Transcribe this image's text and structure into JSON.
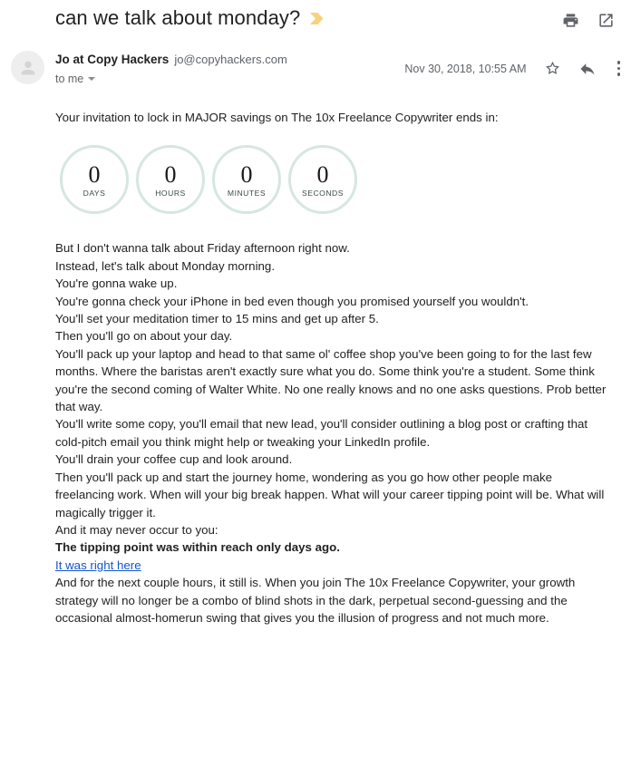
{
  "email": {
    "subject": "can we talk about monday?",
    "important_marker_color": "#f6d27e",
    "sender_name": "Jo at Copy Hackers",
    "sender_email": "jo@copyhackers.com",
    "recipient": "to me",
    "date": "Nov 30, 2018, 10:55 AM"
  },
  "header_actions": {
    "print_label": "Print all",
    "popout_label": "Open in new window"
  },
  "message_actions": {
    "star_label": "Star",
    "reply_label": "Reply",
    "more_label": "More"
  },
  "countdown": {
    "items": [
      {
        "value": "0",
        "label": "DAYS"
      },
      {
        "value": "0",
        "label": "HOURS"
      },
      {
        "value": "0",
        "label": "MINUTES"
      },
      {
        "value": "0",
        "label": "SECONDS"
      }
    ],
    "border_color": "#d6e6e3"
  },
  "body": {
    "intro": "Your invitation to lock in MAJOR savings on The 10x Freelance Copywriter ends in:",
    "paragraphs": [
      "But I don't wanna talk about Friday afternoon right now.",
      "Instead, let's talk about Monday morning.",
      "You're gonna wake up.",
      "You're gonna check your iPhone in bed even though you promised yourself you wouldn't.",
      "You'll set your meditation timer to 15 mins and get up after 5.",
      "Then you'll go on about your day.",
      "You'll pack up your laptop and head to that same ol' coffee shop you've been going to for the last few months. Where the baristas aren't exactly sure what you do. Some think you're a student. Some think you're the second coming of Walter White. No one really knows and no one asks questions. Prob better that way.",
      "You'll write some copy, you'll email that new lead, you'll consider outlining a blog post or crafting that cold-pitch email you think might help or tweaking your LinkedIn profile.",
      "You'll drain your coffee cup and look around.",
      "Then you'll pack up and start the journey home, wondering as you go how other people make freelancing work. When will your big break happen. What will your career tipping point will be. What will magically trigger it.",
      "And it may never occur to you:"
    ],
    "bold_line": "The tipping point was within reach only days ago.",
    "link_text": "It was right here",
    "closing": "And for the next couple hours, it still is. When you join The 10x Freelance Copywriter, your growth strategy will no longer be a combo of blind shots in the dark, perpetual second-guessing and the occasional almost-homerun swing that gives you the illusion of progress and not much more.",
    "link_color": "#1155cc"
  }
}
